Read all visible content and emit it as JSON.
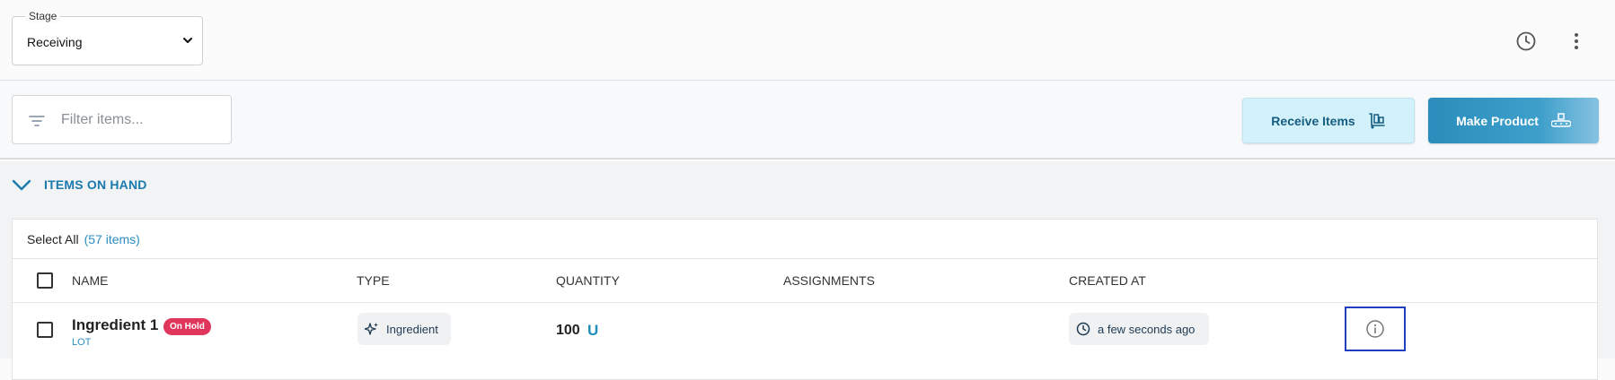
{
  "topbar": {
    "stage_label": "Stage",
    "stage_value": "Receiving",
    "history_icon": "history-clock-icon",
    "more_icon": "more-vertical-icon"
  },
  "actions": {
    "filter_placeholder": "Filter items...",
    "receive_label": "Receive Items",
    "make_label": "Make Product"
  },
  "section": {
    "title": "ITEMS ON HAND",
    "expanded": true
  },
  "table": {
    "select_all_label": "Select All",
    "item_count": "(57 items)",
    "columns": [
      "NAME",
      "TYPE",
      "QUANTITY",
      "ASSIGNMENTS",
      "CREATED AT"
    ],
    "rows": [
      {
        "name": "Ingredient 1",
        "badge": "On Hold",
        "subtype": "LOT",
        "type": "Ingredient",
        "quantity": "100",
        "unit": "U",
        "assignments": "",
        "created_at": "a few seconds ago"
      }
    ]
  },
  "colors": {
    "accent": "#1a79ad",
    "badge_on_hold": "#e0365c",
    "receive_bg": "#d3f1fb",
    "make_bg": "#2a8dbb"
  }
}
